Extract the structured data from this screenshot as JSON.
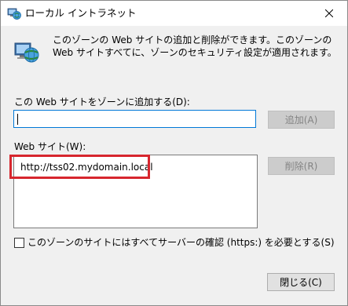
{
  "window": {
    "title": "ローカル イントラネット",
    "close_icon": "close-icon",
    "title_icon": "globe-computer-icon"
  },
  "description": {
    "icon": "globe-computer-icon",
    "text": "このゾーンの Web サイトの追加と削除ができます。このゾーンの Web サイトすべてに、ゾーンのセキュリティ設定が適用されます。"
  },
  "add_section": {
    "label": "この Web サイトをゾーンに追加する(D):",
    "input_value": "",
    "add_button_label": "追加(A)"
  },
  "sites_section": {
    "label": "Web サイト(W):",
    "sites": [
      "http://tss02.mydomain.local"
    ],
    "remove_button_label": "削除(R)"
  },
  "https_option": {
    "label": "このゾーンのサイトにはすべてサーバーの確認 (https:) を必要とする(S)",
    "checked": false
  },
  "footer": {
    "close_button_label": "閉じる(C)"
  },
  "colors": {
    "highlight": "#d7262e",
    "input_focus": "#0078d7"
  }
}
